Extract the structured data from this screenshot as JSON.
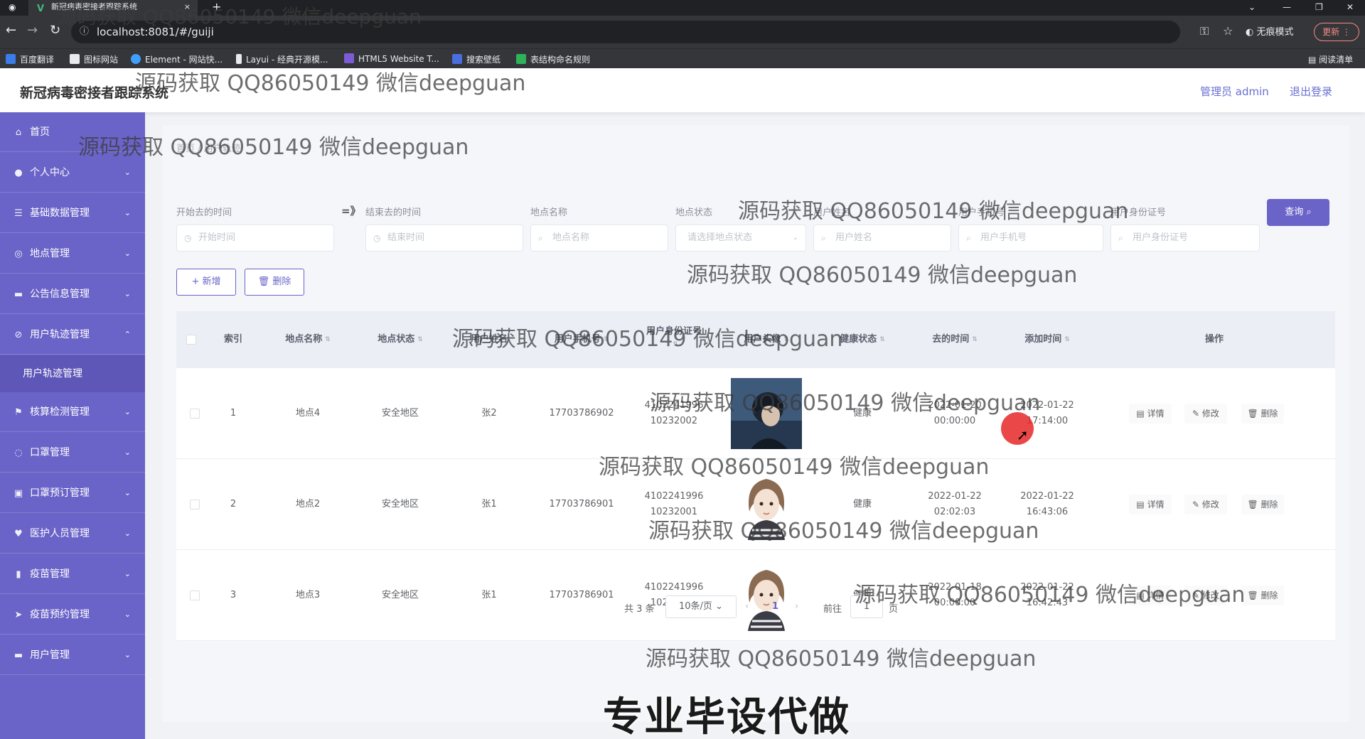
{
  "browser": {
    "tab_title": "新冠病毒密接者跟踪系统",
    "tab_close": "×",
    "new_tab": "+",
    "url": "localhost:8081/#/guiji",
    "incognito_label": "无痕模式",
    "update_label": "更新",
    "bookmarks": [
      "百度翻译",
      "图标网站",
      "Element - 网站快...",
      "Layui - 经典开源模...",
      "HTML5 Website T...",
      "搜索壁纸",
      "表结构命名规则"
    ],
    "reading_list": "阅读清单"
  },
  "header": {
    "title": "新冠病毒密接者跟踪系统",
    "admin": "管理员 admin",
    "logout": "退出登录"
  },
  "sidebar": {
    "items": [
      {
        "label": "首页",
        "icon": "home-icon"
      },
      {
        "label": "个人中心",
        "icon": "user-icon"
      },
      {
        "label": "基础数据管理",
        "icon": "list-icon"
      },
      {
        "label": "地点管理",
        "icon": "location-icon"
      },
      {
        "label": "公告信息管理",
        "icon": "notice-icon"
      },
      {
        "label": "用户轨迹管理",
        "icon": "track-icon"
      },
      {
        "label": "核算检测管理",
        "icon": "flag-icon"
      },
      {
        "label": "口罩管理",
        "icon": "mask-icon"
      },
      {
        "label": "口罩预订管理",
        "icon": "order-icon"
      },
      {
        "label": "医护人员管理",
        "icon": "medic-icon"
      },
      {
        "label": "疫苗管理",
        "icon": "vaccine-icon"
      },
      {
        "label": "疫苗预约管理",
        "icon": "appointment-icon"
      },
      {
        "label": "用户管理",
        "icon": "users-icon"
      }
    ],
    "subitem": "用户轨迹管理"
  },
  "breadcrumb": "首页 / 用户轨迹",
  "filters": {
    "start_label": "开始去的时间",
    "start_placeholder": "开始时间",
    "end_label": "结束去的时间",
    "end_placeholder": "结束时间",
    "place_label": "地点名称",
    "place_placeholder": "地点名称",
    "status_label": "地点状态",
    "status_placeholder": "请选择地点状态",
    "name_label": "用户姓名",
    "name_placeholder": "用户姓名",
    "phone_label": "用户手机号",
    "phone_placeholder": "用户手机号",
    "idcard_label": "用户身份证号",
    "idcard_placeholder": "用户身份证号",
    "search": "查询",
    "separator": "=》"
  },
  "actions": {
    "add": "+ 新增",
    "delete": "删除"
  },
  "table": {
    "headers": [
      "索引",
      "地点名称",
      "地点状态",
      "用户姓名",
      "用户手机号",
      "用户身份证号",
      "用户头像",
      "健康状态",
      "去的时间",
      "添加时间",
      "操作"
    ],
    "rows": [
      {
        "index": "1",
        "place": "地点4",
        "status": "安全地区",
        "name": "张2",
        "phone": "17703786902",
        "idcard": "410224199610232002",
        "health": "健康",
        "go_time": "2022-01-20 00:00:00",
        "add_time": "2022-01-22 17:14:00"
      },
      {
        "index": "2",
        "place": "地点2",
        "status": "安全地区",
        "name": "张1",
        "phone": "17703786901",
        "idcard": "410224199610232001",
        "health": "健康",
        "go_time": "2022-01-22 02:02:03",
        "add_time": "2022-01-22 16:43:06"
      },
      {
        "index": "3",
        "place": "地点3",
        "status": "安全地区",
        "name": "张1",
        "phone": "17703786901",
        "idcard": "410224199610232001",
        "health": "健康",
        "go_time": "2022-01-18 00:00:00",
        "add_time": "2022-01-22 16:42:43"
      }
    ],
    "ops": {
      "detail": "详情",
      "edit": "修改",
      "remove": "删除"
    }
  },
  "pagination": {
    "total": "共 3 条",
    "page_size": "10条/页",
    "page": "1",
    "goto": "前往",
    "goto_value": "1",
    "page_unit": "页"
  },
  "overlay": {
    "watermark": "源码获取 QQ86050149 微信deepguan",
    "caption": "专业毕设代做"
  }
}
